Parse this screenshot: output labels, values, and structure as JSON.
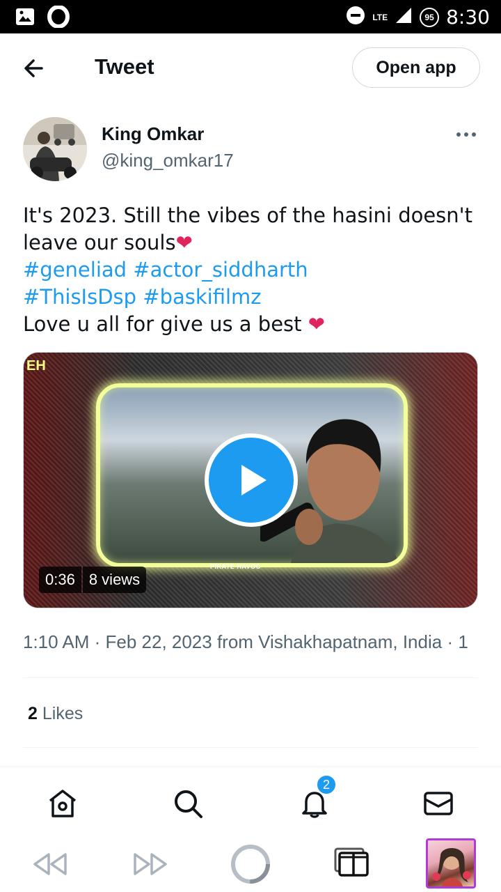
{
  "status_bar": {
    "time": "8:30",
    "network": "LTE",
    "battery": "95"
  },
  "header": {
    "title": "Tweet",
    "open_app_label": "Open app"
  },
  "author": {
    "name": "King Omkar",
    "handle": "@king_omkar17"
  },
  "tweet": {
    "line1": "It's 2023. Still the vibes of the hasini doesn't",
    "line2": "leave our souls",
    "tag1": "#geneliad",
    "tag2": "#actor_siddharth",
    "tag3": "#ThisIsDsp",
    "tag4": "#baskifilmz",
    "line5": "Love u all for give us a best",
    "heart": "❤"
  },
  "media": {
    "duration": "0:36",
    "views": "8 views",
    "watermark": "PIRATE HAVOC",
    "logo": "EH"
  },
  "timestamp": "1:10 AM · Feb 22, 2023 from Vishakhapatnam, India · 1",
  "likes": {
    "count": "2",
    "label": "Likes"
  },
  "bottom_nav": {
    "notification_count": "2"
  }
}
